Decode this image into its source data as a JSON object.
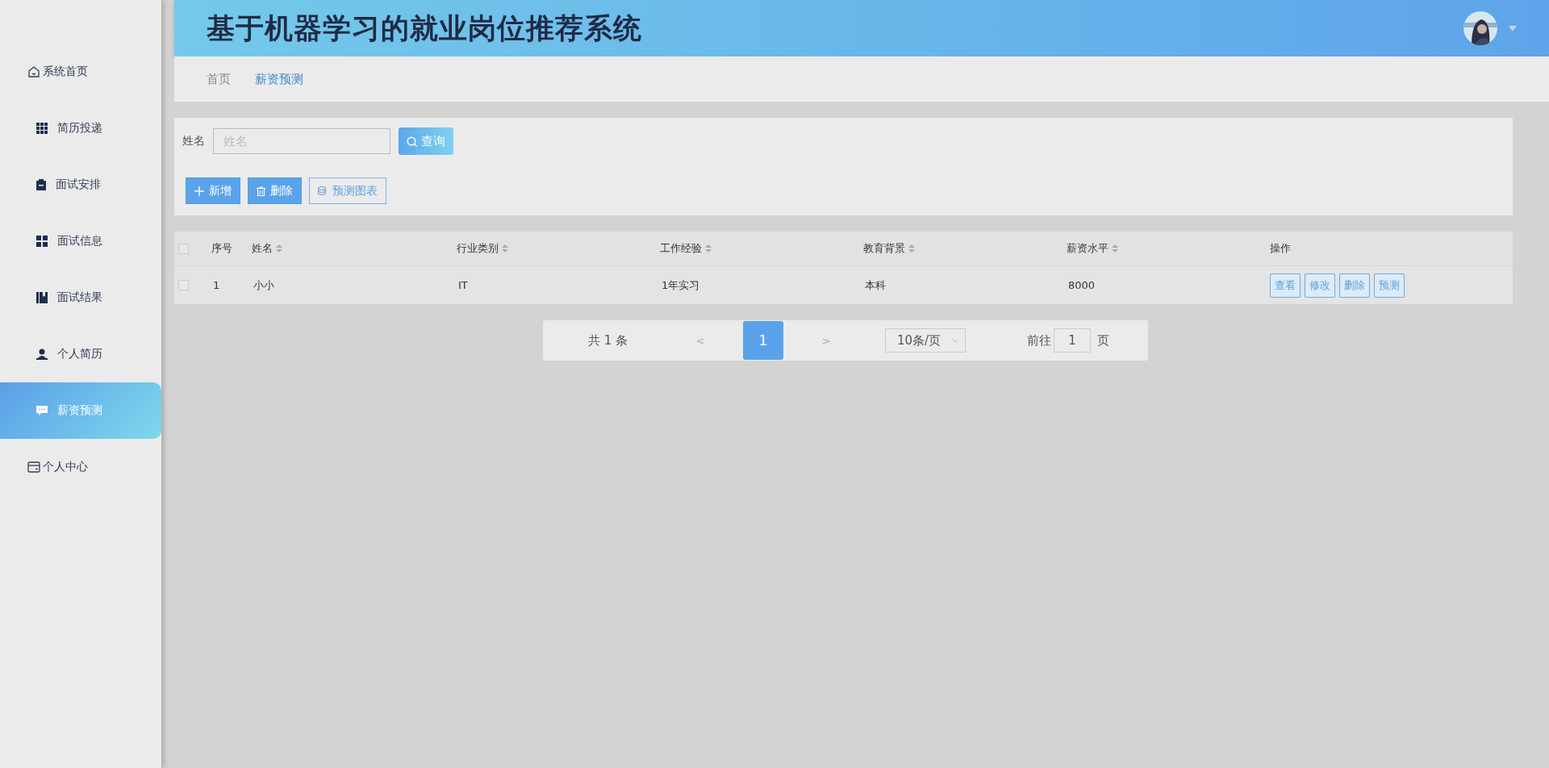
{
  "sidebar": {
    "items": [
      {
        "label": "系统首页",
        "selected": false
      },
      {
        "label": "简历投递",
        "selected": false
      },
      {
        "label": "面试安排",
        "selected": false
      },
      {
        "label": "面试信息",
        "selected": false
      },
      {
        "label": "面试结果",
        "selected": false
      },
      {
        "label": "个人简历",
        "selected": false
      },
      {
        "label": "薪资预测",
        "selected": true
      },
      {
        "label": "个人中心",
        "selected": false
      }
    ]
  },
  "header": {
    "title": "基于机器学习的就业岗位推荐系统"
  },
  "breadcrumb": [
    {
      "label": "首页",
      "selected": false
    },
    {
      "label": "薪资预测",
      "selected": true
    }
  ],
  "search": {
    "label": "姓名",
    "placeholder": "姓名",
    "button": "查询"
  },
  "toolbar": [
    {
      "label": "新增",
      "kind": "add"
    },
    {
      "label": "删除",
      "kind": "delete"
    },
    {
      "label": "预测图表",
      "kind": "chart"
    }
  ],
  "table": {
    "select_all": {
      "checked": false
    },
    "columns": [
      {
        "label": "序号",
        "sortable": false
      },
      {
        "label": "姓名",
        "sortable": true
      },
      {
        "label": "行业类别",
        "sortable": true
      },
      {
        "label": "工作经验",
        "sortable": true
      },
      {
        "label": "教育背景",
        "sortable": true
      },
      {
        "label": "薪资水平",
        "sortable": true
      },
      {
        "label": "操作",
        "sortable": false
      }
    ],
    "rows": [
      {
        "checked": false,
        "cells": [
          "1",
          "小小",
          "IT",
          "1年实习",
          "本科",
          "8000"
        ],
        "actions": [
          "查看",
          "修改",
          "删除",
          "预测"
        ]
      }
    ]
  },
  "pagination": {
    "total": "共 1 条",
    "prev": "<",
    "pages": [
      {
        "label": "1",
        "selected": true
      }
    ],
    "next": ">",
    "page_size": "10条/页",
    "goto_label": "前往",
    "goto_value": "1",
    "goto_suffix": "页"
  }
}
